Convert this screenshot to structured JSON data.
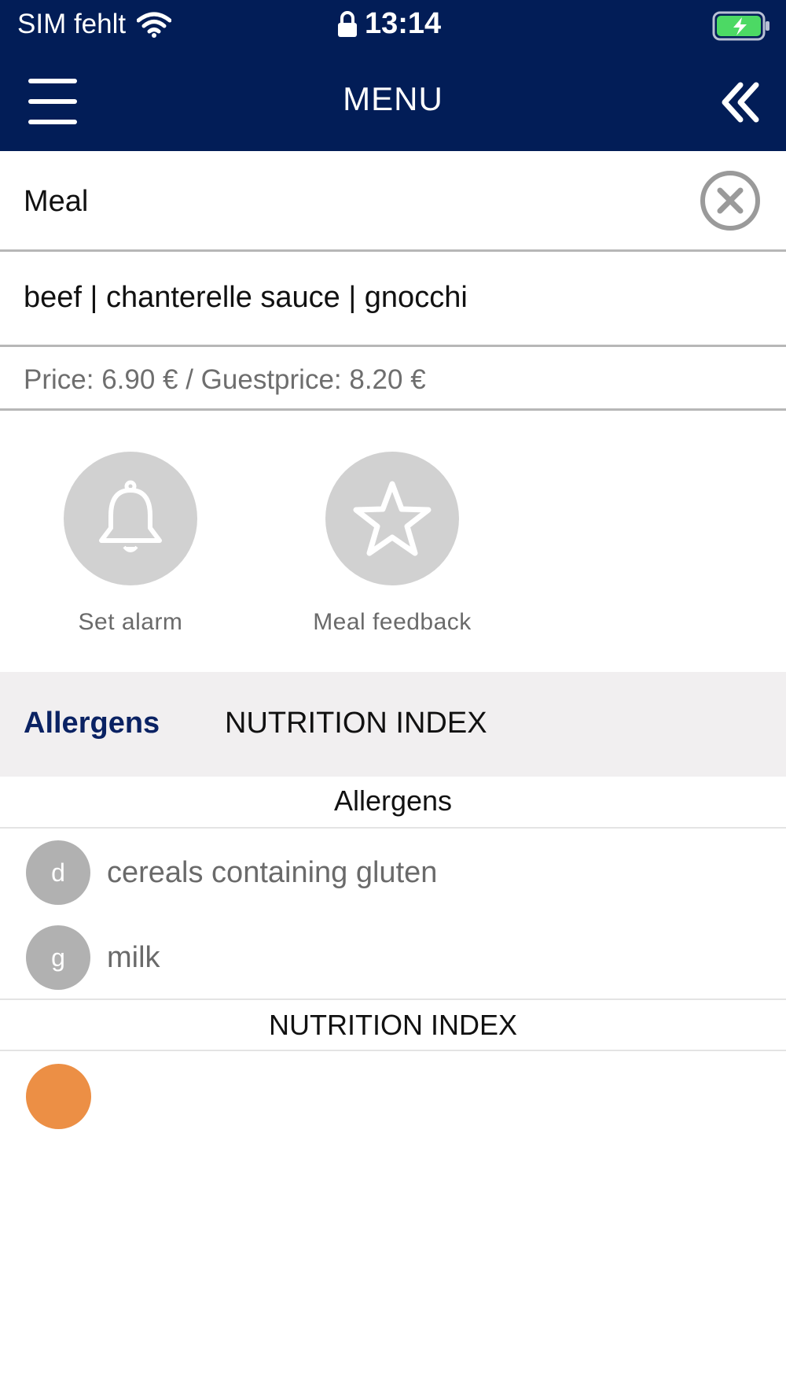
{
  "status_bar": {
    "carrier": "SIM fehlt",
    "time": "13:14",
    "wifi_icon": "wifi-icon",
    "lock_icon": "lock-icon",
    "battery_icon": "battery-charging-icon",
    "battery_color": "#4cd964"
  },
  "nav": {
    "title": "MENU",
    "menu_icon": "hamburger-icon",
    "back_icon": "double-chevron-left-icon",
    "background": "#021d57"
  },
  "meal": {
    "label": "Meal",
    "close_icon": "close-circle-icon",
    "dish": "beef | chanterelle sauce | gnocchi",
    "price": "Price: 6.90 € / Guestprice: 8.20 €"
  },
  "actions": [
    {
      "label": "Set alarm",
      "icon": "bell-icon"
    },
    {
      "label": "Meal feedback",
      "icon": "star-icon"
    }
  ],
  "tabs": [
    {
      "label": "Allergens",
      "active": true
    },
    {
      "label": "NUTRITION INDEX",
      "active": false
    }
  ],
  "allergens": {
    "title": "Allergens",
    "items": [
      {
        "code": "d",
        "name": "cereals containing gluten"
      },
      {
        "code": "g",
        "name": "milk"
      }
    ]
  },
  "nutrition": {
    "title": "NUTRITION INDEX",
    "indicator_color": "#ec8f45"
  }
}
